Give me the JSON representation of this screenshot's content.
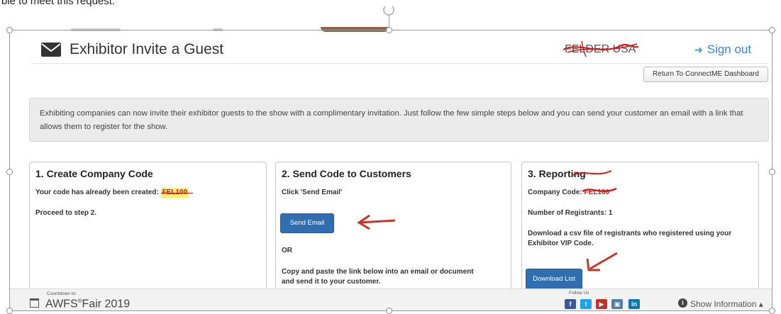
{
  "crop_text": "ble to meet this request.",
  "header": {
    "title": "Exhibitor Invite a Guest",
    "company": "FELDER USA",
    "signout_icon": "➔",
    "signout_label": "Sign out"
  },
  "return_button": "Return To ConnectME Dashboard",
  "banner_text": "Exhibiting companies can now invite their exhibitor guests to the show with a complimentary invitation. Just follow the few simple steps below and you can send your customer an email with a link that allows them to register for the show.",
  "panels": {
    "create": {
      "title": "1. Create Company Code",
      "code_text": "Your code has already been created:",
      "code": "FEL100",
      "proceed": "Proceed to step 2."
    },
    "send": {
      "title": "2. Send Code to Customers",
      "instruction": "Click 'Send Email'",
      "send_button": "Send Email",
      "or": "OR",
      "copy_text": "Copy and paste the link below into an email or document and send it to your customer."
    },
    "report": {
      "title": "3. Reporting",
      "code_label": "Company Code:",
      "code": "FEL100",
      "registrants": "Number of Registrants: 1",
      "download_text": "Download a csv file of registrants who registered using your Exhibitor VIP Code.",
      "download_button": "Download List"
    }
  },
  "footer": {
    "countdown_label": "Countdown to:",
    "fair_prefix": "AWFS",
    "fair_reg": "®",
    "fair_suffix": "Fair 2019",
    "follow_label": "Follow Us",
    "social": [
      {
        "icon": "facebook-icon",
        "glyph": "f",
        "color": "#3b5998"
      },
      {
        "icon": "twitter-icon",
        "glyph": "t",
        "color": "#1da1f2"
      },
      {
        "icon": "youtube-icon",
        "glyph": "▶",
        "color": "#c4302b"
      },
      {
        "icon": "instagram-icon",
        "glyph": "▣",
        "color": "#517fa4"
      },
      {
        "icon": "linkedin-icon",
        "glyph": "in",
        "color": "#0e76a8"
      }
    ],
    "info_glyph": "i",
    "show_info": "Show Information ▴"
  },
  "colors": {
    "accent": "#2f6fb1",
    "link": "#3a86c8",
    "annotation": "#d01818",
    "highlight": "#f6f26a"
  }
}
